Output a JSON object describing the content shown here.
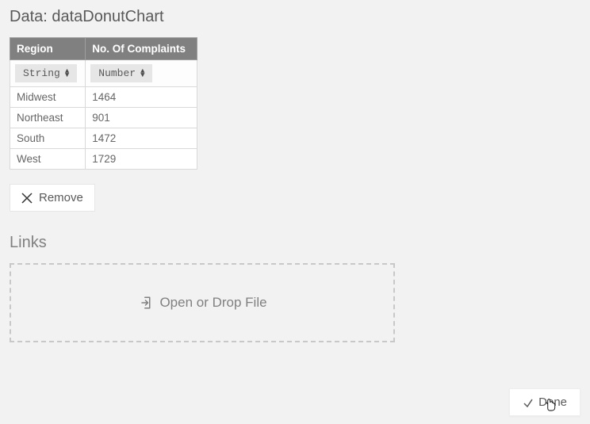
{
  "header_title": "Data: dataDonutChart",
  "table": {
    "columns": [
      {
        "header": "Region",
        "type_label": "String"
      },
      {
        "header": "No. Of Complaints",
        "type_label": "Number"
      }
    ],
    "rows": [
      [
        "Midwest",
        "1464"
      ],
      [
        "Northeast",
        "901"
      ],
      [
        "South",
        "1472"
      ],
      [
        "West",
        "1729"
      ]
    ]
  },
  "remove_label": "Remove",
  "links_title": "Links",
  "dropzone_label": "Open or Drop File",
  "done_label": "Done",
  "chart_data": {
    "type": "table",
    "title": "dataDonutChart",
    "columns": [
      "Region",
      "No. Of Complaints"
    ],
    "rows": [
      [
        "Midwest",
        1464
      ],
      [
        "Northeast",
        901
      ],
      [
        "South",
        1472
      ],
      [
        "West",
        1729
      ]
    ]
  }
}
